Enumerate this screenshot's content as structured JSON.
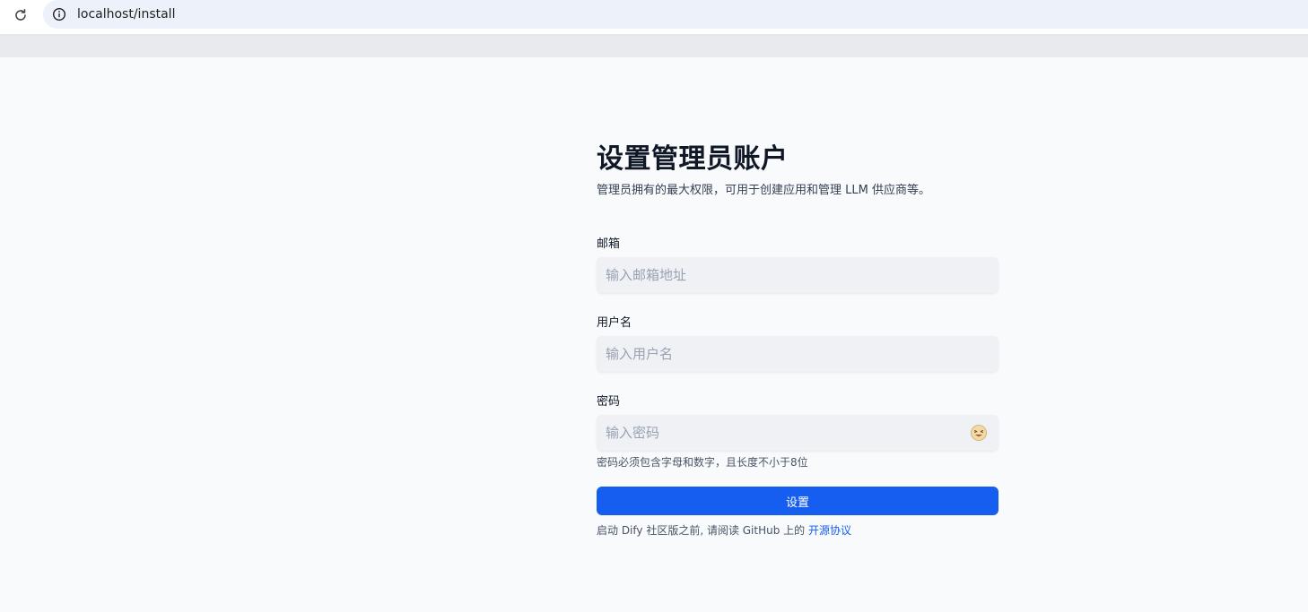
{
  "browser": {
    "url": "localhost/install"
  },
  "page": {
    "title": "设置管理员账户",
    "subtitle": "管理员拥有的最大权限，可用于创建应用和管理 LLM 供应商等。"
  },
  "form": {
    "email": {
      "label": "邮箱",
      "placeholder": "输入邮箱地址",
      "value": ""
    },
    "username": {
      "label": "用户名",
      "placeholder": "输入用户名",
      "value": ""
    },
    "password": {
      "label": "密码",
      "placeholder": "输入密码",
      "value": "",
      "toggle_icon": "emoji-squint-tongue-icon",
      "hint": "密码必须包含字母和数字，且长度不小于8位"
    },
    "submit_label": "设置"
  },
  "footer": {
    "text": "启动 Dify 社区版之前, 请阅读 GitHub 上的",
    "link_label": "开源协议"
  },
  "colors": {
    "primary": "#155eef",
    "input_bg": "#f0f1f4",
    "page_bg": "#f9fafb"
  }
}
